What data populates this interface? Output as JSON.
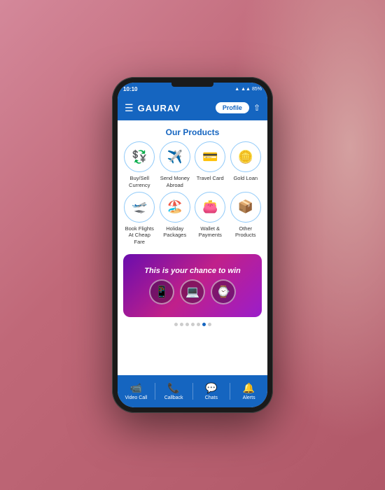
{
  "background": {
    "color": "#c97b8a"
  },
  "phone": {
    "status_bar": {
      "time": "10:10",
      "battery": "85%",
      "signal": "●●●"
    },
    "header": {
      "menu_icon": "☰",
      "title": "GAURAV",
      "profile_button": "Profile",
      "share_icon": "⇧"
    },
    "products_section": {
      "title": "Our Products",
      "items": [
        {
          "id": "buy-sell-currency",
          "label": "Buy/Sell\nCurrency",
          "icon": "💱"
        },
        {
          "id": "send-money-abroad",
          "label": "Send Money\nAbroad",
          "icon": "✈️"
        },
        {
          "id": "travel-card",
          "label": "Travel Card",
          "icon": "💳"
        },
        {
          "id": "gold-loan",
          "label": "Gold Loan",
          "icon": "🪙"
        },
        {
          "id": "book-flights",
          "label": "Book Flights\nAt Cheap\nFare",
          "icon": "✈️"
        },
        {
          "id": "holiday-packages",
          "label": "Holiday\nPackages",
          "icon": "🏖️"
        },
        {
          "id": "wallet-payments",
          "label": "Wallet &\nPayments",
          "icon": "👛"
        },
        {
          "id": "other-products",
          "label": "Other\nProducts",
          "icon": "📦"
        }
      ]
    },
    "banner": {
      "text": "This is your chance to win",
      "icons": [
        "📱",
        "💻",
        "⌚"
      ],
      "dots": [
        false,
        false,
        false,
        false,
        false,
        true,
        false
      ]
    },
    "bottom_nav": {
      "items": [
        {
          "id": "video-call",
          "label": "Video Call",
          "icon": "📹"
        },
        {
          "id": "callback",
          "label": "Callback",
          "icon": "📞"
        },
        {
          "id": "chats",
          "label": "Chats",
          "icon": "💬"
        },
        {
          "id": "alerts",
          "label": "Alerts",
          "icon": "🔔"
        }
      ]
    }
  }
}
